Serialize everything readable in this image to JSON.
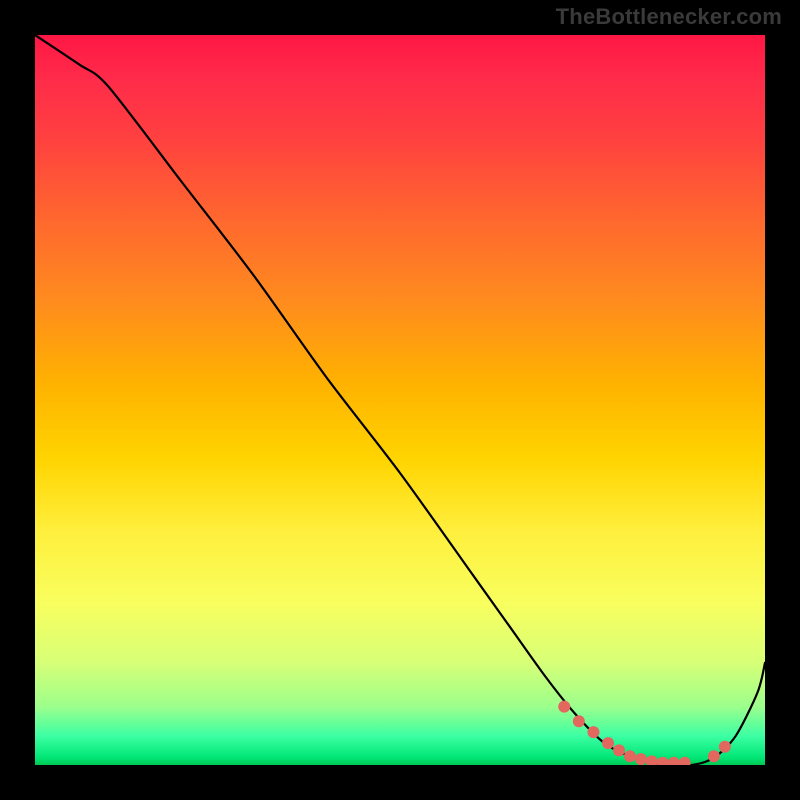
{
  "watermark": "TheBottlenecker.com",
  "chart_data": {
    "type": "line",
    "title": "",
    "xlabel": "",
    "ylabel": "",
    "xlim": [
      0,
      100
    ],
    "ylim": [
      0,
      100
    ],
    "series": [
      {
        "name": "bottleneck-curve",
        "x": [
          0,
          6,
          10,
          20,
          30,
          40,
          50,
          60,
          65,
          70,
          74,
          78,
          82,
          86,
          90,
          93,
          96,
          99,
          100
        ],
        "y": [
          100,
          96,
          93,
          80,
          67,
          53,
          40,
          26,
          19,
          12,
          7,
          3,
          1,
          0,
          0,
          1,
          4,
          10,
          14
        ]
      }
    ],
    "markers": {
      "name": "highlight-dots",
      "x": [
        72.5,
        74.5,
        76.5,
        78.5,
        80.0,
        81.5,
        83.0,
        84.5,
        86.0,
        87.5,
        89.0,
        93.0,
        94.5
      ],
      "y": [
        8.0,
        6.0,
        4.5,
        3.0,
        2.0,
        1.2,
        0.8,
        0.5,
        0.3,
        0.3,
        0.3,
        1.2,
        2.5
      ]
    },
    "colors": {
      "marker": "#e2675e",
      "curve": "#000000",
      "frame": "#000000"
    }
  }
}
